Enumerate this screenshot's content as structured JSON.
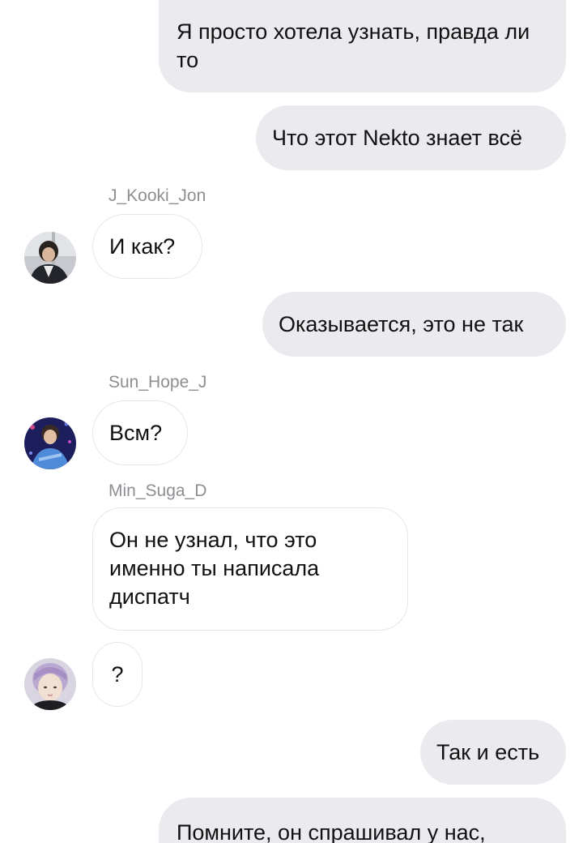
{
  "messages": {
    "m1": "Я просто хотела узнать, правда ли то",
    "m2": "Что этот Nekto знает всё",
    "m3": "И как?",
    "m4": "Оказывается, это не так",
    "m5": "Всм?",
    "m6": "Он не узнал, что это именно ты написала диспатч",
    "m7": "?",
    "m8": "Так и есть",
    "m9": "Помните, он спрашивал у нас,"
  },
  "senders": {
    "kooki": "J_Kooki_Jon",
    "hope": "Sun_Hope_J",
    "suga": "Min_Suga_D"
  },
  "colors": {
    "outgoing_bubble": "#ebebef",
    "incoming_border": "#e6e6ea",
    "sender_name": "#8e8e93"
  }
}
